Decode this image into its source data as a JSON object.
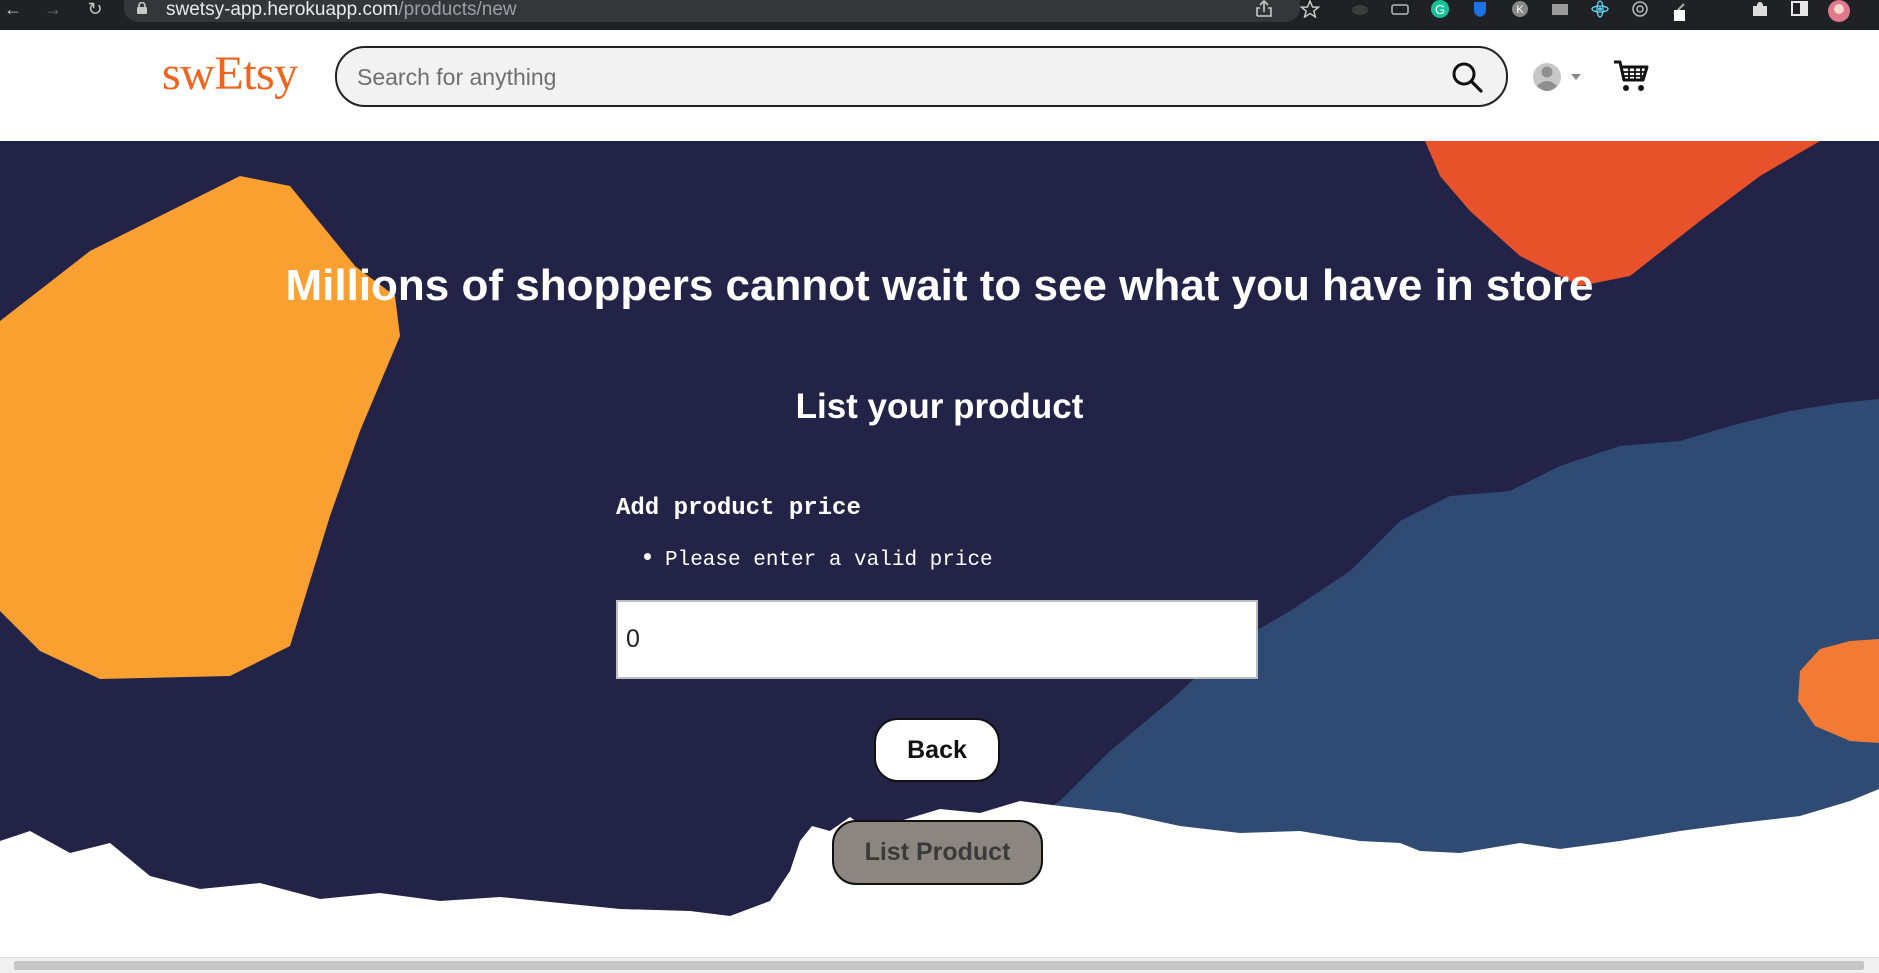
{
  "browser": {
    "url_domain": "swetsy-app.herokuapp.com",
    "url_path": "/products/new",
    "icons": [
      "back-arrow-icon",
      "forward-arrow-icon",
      "reload-icon",
      "lock-icon",
      "share-icon",
      "star-icon",
      "grammarly-icon",
      "extensions-icon",
      "profile-icon"
    ]
  },
  "header": {
    "logo": "swEtsy",
    "search_placeholder": "Search for anything",
    "search_value": ""
  },
  "hero": {
    "headline": "Millions of shoppers cannot wait to see what you have in store"
  },
  "form": {
    "title": "List your product",
    "label": "Add product price",
    "errors": [
      "Please enter a valid price"
    ],
    "price_value": "0",
    "back_label": "Back",
    "submit_label": "List Product"
  },
  "colors": {
    "brand": "#f1641e",
    "hero_bg": "#232347",
    "blue_shape": "#2f4a73",
    "yellow_shape": "#f9a031",
    "orange_shape": "#e8522a",
    "submit_disabled": "#8c8681"
  }
}
